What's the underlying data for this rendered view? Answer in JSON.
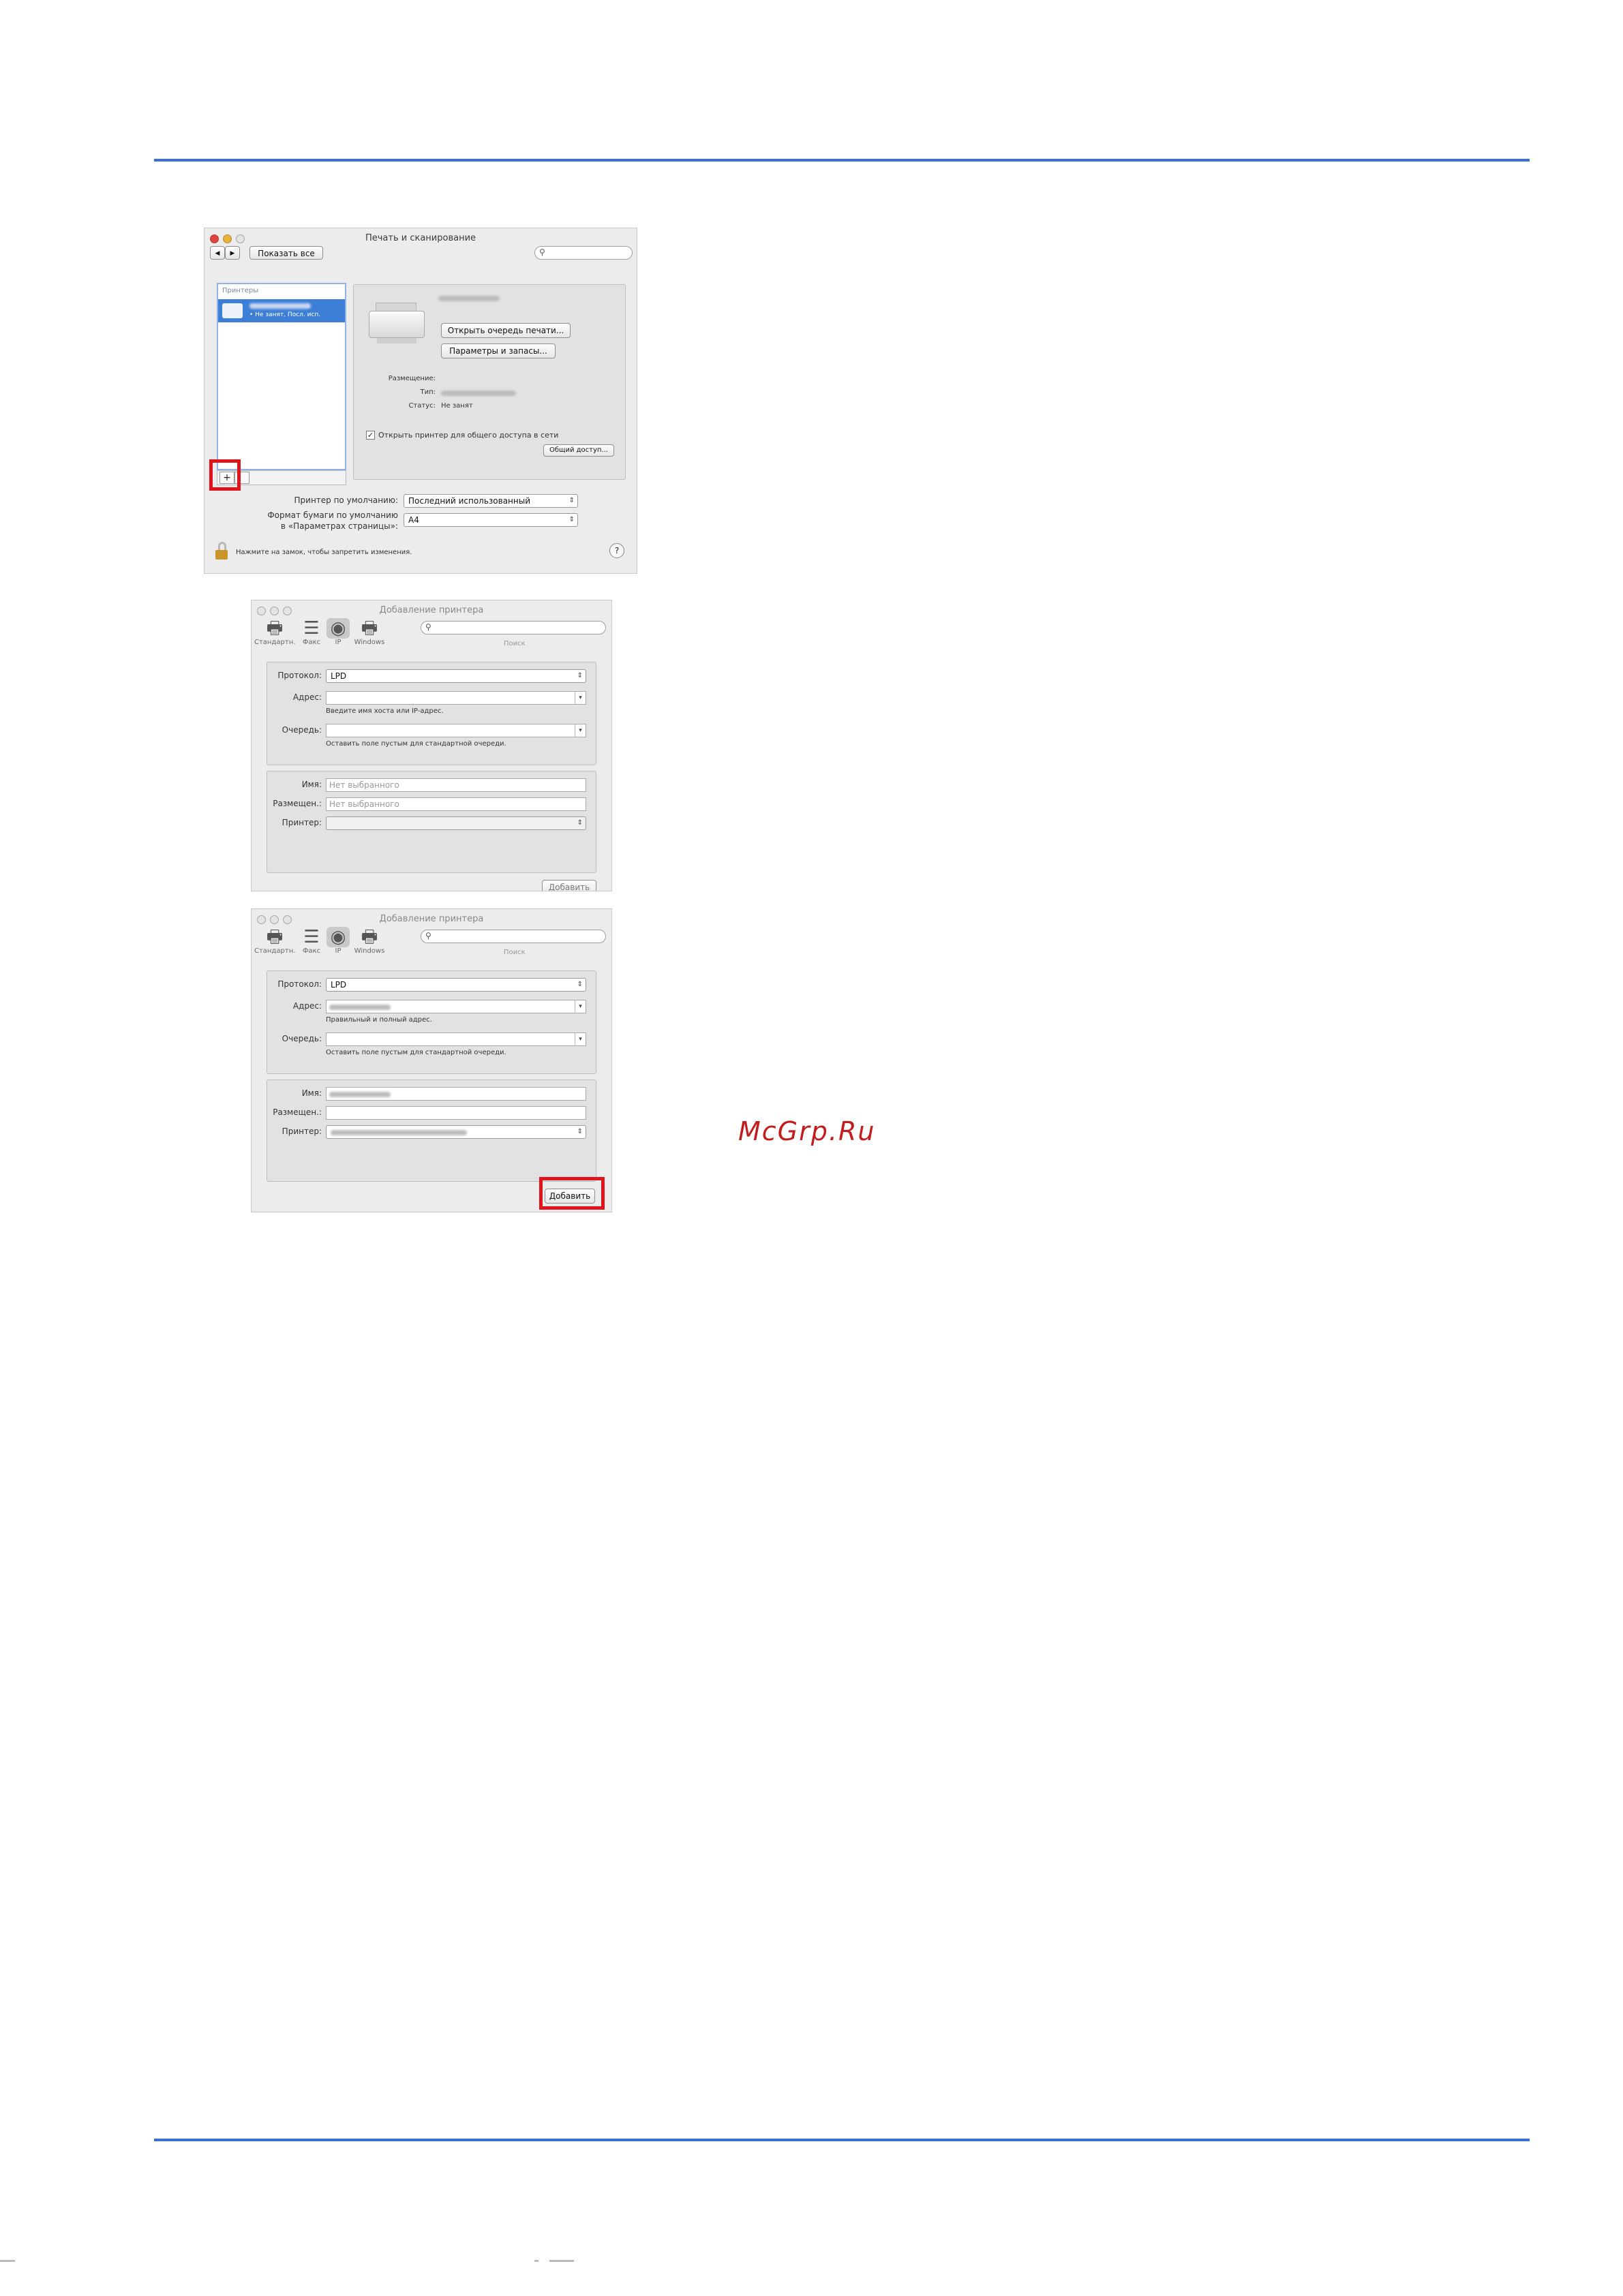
{
  "window1": {
    "title": "Печать и сканирование",
    "show_all": "Показать все",
    "nav_back": "◀",
    "nav_fwd": "▶",
    "printers_header": "Принтеры",
    "printer_item_status": "• Не занят, Посл. исп.",
    "open_queue": "Открыть очередь печати...",
    "options_supplies": "Параметры и запасы...",
    "location_label": "Размещение:",
    "type_label": "Тип:",
    "status_label": "Статус:",
    "status_value": "Не занят",
    "share_checkbox": "Открыть принтер для общего доступа в сети",
    "sharing_button": "Общий доступ...",
    "add_button": "+",
    "default_printer_label": "Принтер по умолчанию:",
    "default_printer_value": "Последний использованный",
    "paper_format_label_1": "Формат бумаги по умолчанию",
    "paper_format_label_2": "в «Параметрах страницы»:",
    "paper_format_value": "A4",
    "lock_text": "Нажмите на замок, чтобы запретить изменения.",
    "help": "?"
  },
  "window2": {
    "title": "Добавление принтера",
    "tools": [
      "Стандартн.",
      "Факс",
      "IP",
      "Windows"
    ],
    "search_label": "Поиск",
    "protocol_label": "Протокол:",
    "protocol_value": "LPD",
    "address_label": "Адрес:",
    "address_hint": "Введите имя хоста или IP-адрес.",
    "queue_label": "Очередь:",
    "queue_hint": "Оставить поле пустым для стандартной очереди.",
    "name_label": "Имя:",
    "name_placeholder": "Нет выбранного",
    "location_label": "Размещен.:",
    "location_placeholder": "Нет выбранного",
    "printer_label": "Принтер:",
    "add_button": "Добавить"
  },
  "window3": {
    "title": "Добавление принтера",
    "tools": [
      "Стандартн.",
      "Факс",
      "IP",
      "Windows"
    ],
    "search_label": "Поиск",
    "protocol_label": "Протокол:",
    "protocol_value": "LPD",
    "address_label": "Адрес:",
    "address_hint": "Правильный и полный адрес.",
    "queue_label": "Очередь:",
    "queue_hint": "Оставить поле пустым для стандартной очереди.",
    "name_label": "Имя:",
    "location_label": "Размещен.:",
    "printer_label": "Принтер:",
    "add_button": "Добавить"
  },
  "watermark": "McGrp.Ru",
  "colors": {
    "rule": "#3a6fd8",
    "highlight": "#e0141b",
    "watermark": "#c21d1d"
  }
}
